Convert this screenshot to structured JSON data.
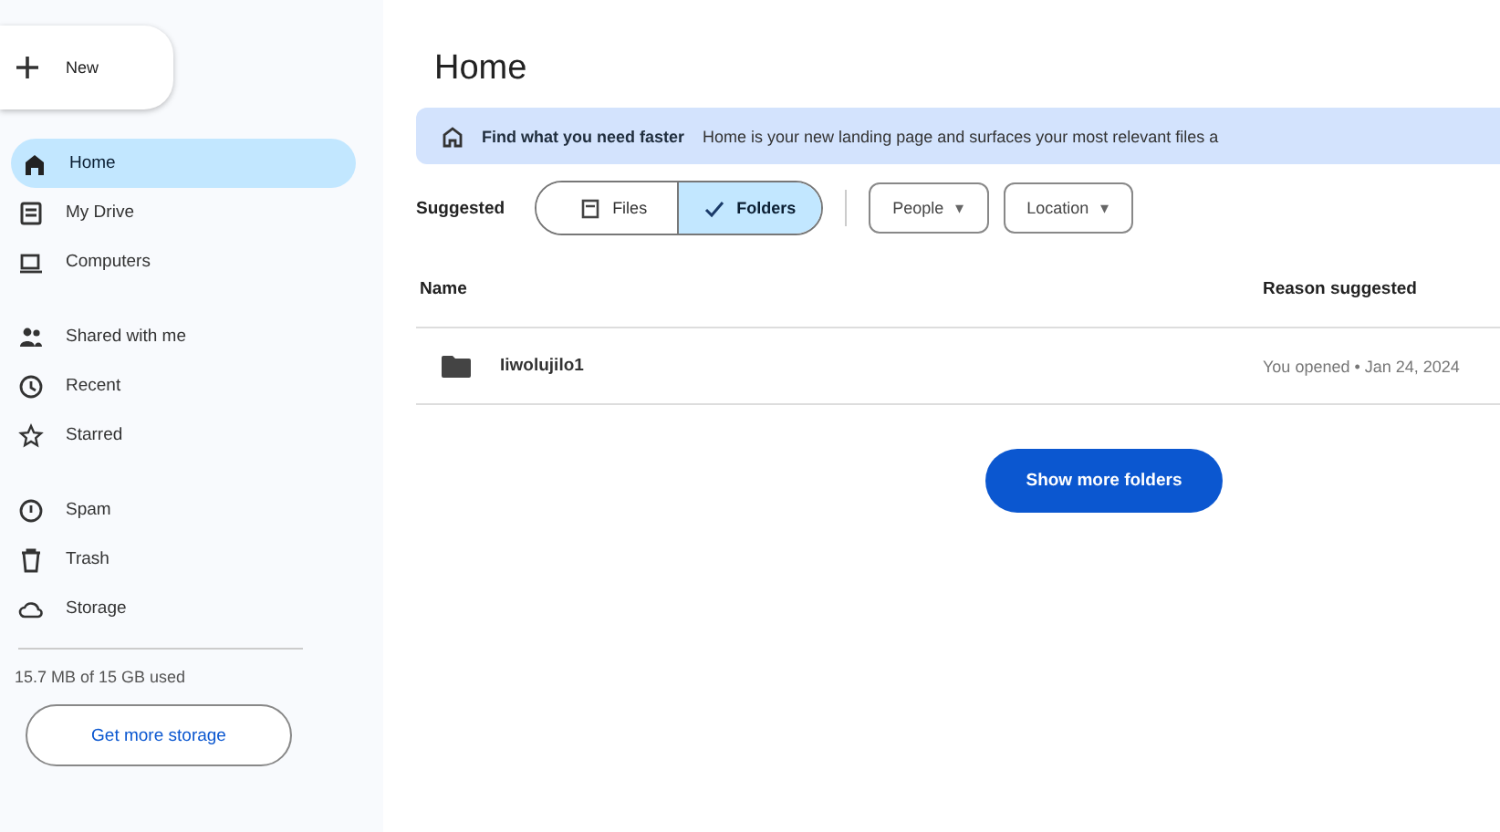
{
  "new_button": {
    "label": "New"
  },
  "sidebar": {
    "groups": [
      [
        {
          "label": "Home",
          "selected": true
        },
        {
          "label": "My Drive",
          "selected": false
        },
        {
          "label": "Computers",
          "selected": false
        }
      ],
      [
        {
          "label": "Shared with me",
          "selected": false
        },
        {
          "label": "Recent",
          "selected": false
        },
        {
          "label": "Starred",
          "selected": false
        }
      ],
      [
        {
          "label": "Spam",
          "selected": false
        },
        {
          "label": "Trash",
          "selected": false
        },
        {
          "label": "Storage",
          "selected": false
        }
      ]
    ],
    "storage_text": "15.7 MB of 15 GB used",
    "storage_button": "Get more storage"
  },
  "page_title": "Home",
  "banner": {
    "title": "Find what you need faster",
    "text": "Home is your new landing page and surfaces your most relevant files a"
  },
  "filters": {
    "label": "Suggested",
    "toggle": [
      {
        "label": "Files",
        "selected": false
      },
      {
        "label": "Folders",
        "selected": true
      }
    ],
    "dropdowns": [
      {
        "label": "People",
        "caret": "▾"
      },
      {
        "label": "Location",
        "caret": "▾"
      }
    ]
  },
  "table": {
    "columns": [
      "Name",
      "Reason suggested"
    ],
    "rows": [
      {
        "name": "Iiwolujilo1",
        "reason": "You opened • Jan 24, 2024"
      }
    ]
  },
  "more_button": "Show more folders"
}
